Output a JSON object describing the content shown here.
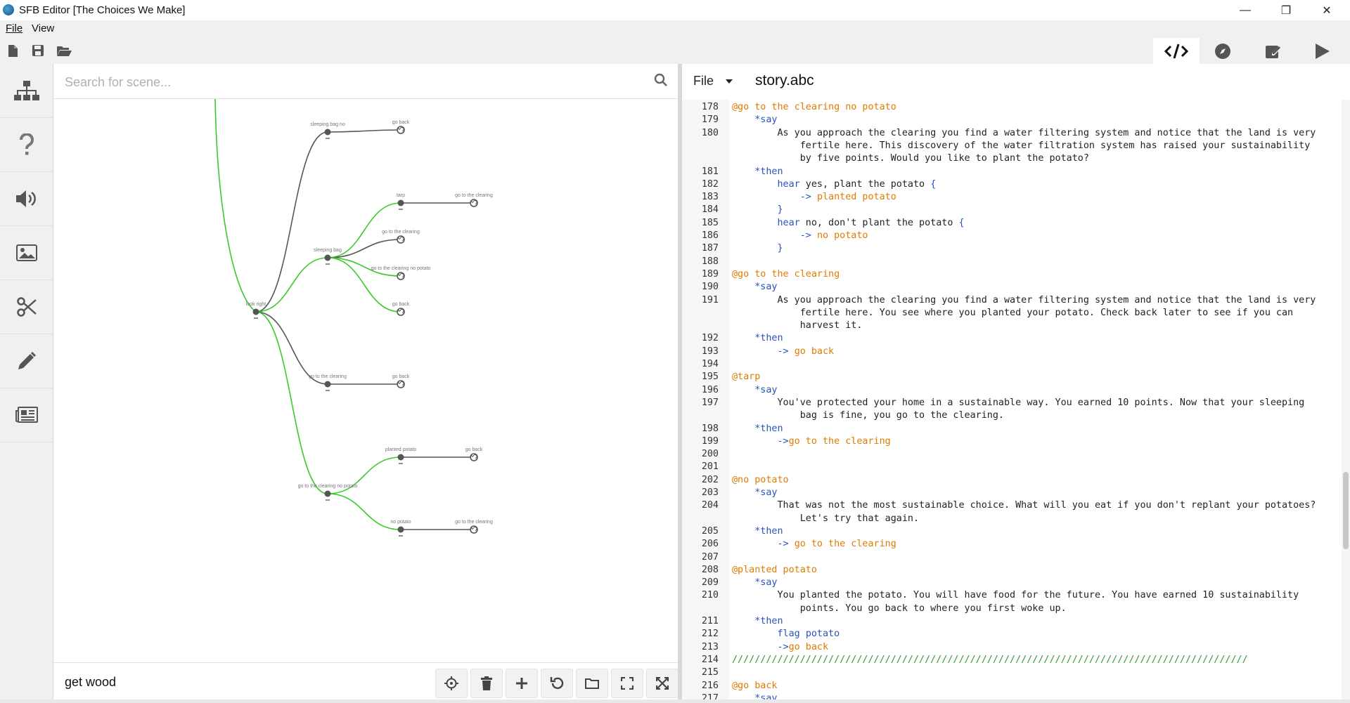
{
  "window": {
    "title": "SFB Editor [The Choices We Make]",
    "controls": {
      "minimize": "—",
      "maximize": "❐",
      "close": "✕"
    }
  },
  "menubar": {
    "items": [
      "File",
      "View"
    ]
  },
  "toolbar": {
    "left_icons": [
      "new-file-icon",
      "save-icon",
      "open-folder-icon"
    ],
    "right_tabs": [
      {
        "name": "code-tab",
        "icon": "code-icon",
        "active": true
      },
      {
        "name": "compass-tab",
        "icon": "compass-icon",
        "active": false
      },
      {
        "name": "edit-tab",
        "icon": "pencil-square-icon",
        "active": false
      },
      {
        "name": "play-tab",
        "icon": "play-icon",
        "active": false
      }
    ]
  },
  "sidebar": {
    "items": [
      "sitemap-icon",
      "question-icon",
      "speaker-icon",
      "image-icon",
      "scissors-icon",
      "pencil-icon",
      "newspaper-icon"
    ]
  },
  "graph": {
    "search_placeholder": "Search for scene...",
    "current_scene": "get wood",
    "nodes": [
      {
        "id": "sleeping_bag_no",
        "label": "sleeping bag no"
      },
      {
        "id": "back1",
        "label": "go back"
      },
      {
        "id": "tarp",
        "label": "tarp"
      },
      {
        "id": "clearing1",
        "label": "go to the clearing"
      },
      {
        "id": "sleeping_bag",
        "label": "sleeping bag"
      },
      {
        "id": "clearing2",
        "label": "go to the clearing"
      },
      {
        "id": "clearing_no_potato1",
        "label": "go to the clearing no potato"
      },
      {
        "id": "back2",
        "label": "go back"
      },
      {
        "id": "look_right",
        "label": "look right"
      },
      {
        "id": "go_clearing",
        "label": "go to the clearing"
      },
      {
        "id": "back3",
        "label": "go back"
      },
      {
        "id": "planted_potato",
        "label": "planted potato"
      },
      {
        "id": "back4",
        "label": "go back"
      },
      {
        "id": "clearing_no_potato",
        "label": "go to the clearing no potato"
      },
      {
        "id": "no_potato",
        "label": "no potato"
      },
      {
        "id": "clearing3",
        "label": "go to the clearing"
      }
    ],
    "colors": {
      "green_edge": "#3cc92b",
      "gray_edge": "#555555",
      "node": "#555555"
    }
  },
  "editor": {
    "file_menu": "File",
    "filename": "story.abc",
    "lines": [
      {
        "n": "178",
        "segs": [
          [
            "c-label",
            "@go to the clearing no potato"
          ]
        ]
      },
      {
        "n": "179",
        "segs": [
          [
            "",
            "    "
          ],
          [
            "c-kw",
            "*say"
          ]
        ]
      },
      {
        "n": "180",
        "segs": [
          [
            "",
            "        As you approach the clearing you find a water filtering system and notice that the land is very"
          ]
        ]
      },
      {
        "n": "",
        "segs": [
          [
            "",
            "            fertile here. This discovery of the water filtration system has raised your sustainability"
          ]
        ]
      },
      {
        "n": "",
        "segs": [
          [
            "",
            "            by five points. Would you like to plant the potato?"
          ]
        ]
      },
      {
        "n": "181",
        "segs": [
          [
            "",
            "    "
          ],
          [
            "c-kw",
            "*then"
          ]
        ]
      },
      {
        "n": "182",
        "segs": [
          [
            "",
            "        "
          ],
          [
            "c-kw",
            "hear"
          ],
          [
            "",
            " yes, plant the potato "
          ],
          [
            "c-brace",
            "{"
          ]
        ]
      },
      {
        "n": "183",
        "segs": [
          [
            "",
            "            "
          ],
          [
            "c-arrow",
            "->"
          ],
          [
            "",
            " "
          ],
          [
            "c-tgt",
            "planted potato"
          ]
        ]
      },
      {
        "n": "184",
        "segs": [
          [
            "",
            "        "
          ],
          [
            "c-brace",
            "}"
          ]
        ]
      },
      {
        "n": "185",
        "segs": [
          [
            "",
            "        "
          ],
          [
            "c-kw",
            "hear"
          ],
          [
            "",
            " no, don't plant the potato "
          ],
          [
            "c-brace",
            "{"
          ]
        ]
      },
      {
        "n": "186",
        "segs": [
          [
            "",
            "            "
          ],
          [
            "c-arrow",
            "->"
          ],
          [
            "",
            " "
          ],
          [
            "c-tgt",
            "no potato"
          ]
        ]
      },
      {
        "n": "187",
        "segs": [
          [
            "",
            "        "
          ],
          [
            "c-brace",
            "}"
          ]
        ]
      },
      {
        "n": "188",
        "segs": [
          [
            "",
            ""
          ]
        ]
      },
      {
        "n": "189",
        "segs": [
          [
            "c-label",
            "@go to the clearing"
          ]
        ]
      },
      {
        "n": "190",
        "segs": [
          [
            "",
            "    "
          ],
          [
            "c-kw",
            "*say"
          ]
        ]
      },
      {
        "n": "191",
        "segs": [
          [
            "",
            "        As you approach the clearing you find a water filtering system and notice that the land is very"
          ]
        ]
      },
      {
        "n": "",
        "segs": [
          [
            "",
            "            fertile here. You see where you planted your potato. Check back later to see if you can"
          ]
        ]
      },
      {
        "n": "",
        "segs": [
          [
            "",
            "            harvest it."
          ]
        ]
      },
      {
        "n": "192",
        "segs": [
          [
            "",
            "    "
          ],
          [
            "c-kw",
            "*then"
          ]
        ]
      },
      {
        "n": "193",
        "segs": [
          [
            "",
            "        "
          ],
          [
            "c-arrow",
            "->"
          ],
          [
            "",
            " "
          ],
          [
            "c-tgt",
            "go back"
          ]
        ]
      },
      {
        "n": "194",
        "segs": [
          [
            "",
            ""
          ]
        ]
      },
      {
        "n": "195",
        "segs": [
          [
            "c-label",
            "@tarp"
          ]
        ]
      },
      {
        "n": "196",
        "segs": [
          [
            "",
            "    "
          ],
          [
            "c-kw",
            "*say"
          ]
        ]
      },
      {
        "n": "197",
        "segs": [
          [
            "",
            "        You've protected your home in a sustainable way. You earned 10 points. Now that your sleeping"
          ]
        ]
      },
      {
        "n": "",
        "segs": [
          [
            "",
            "            bag is fine, you go to the clearing."
          ]
        ]
      },
      {
        "n": "198",
        "segs": [
          [
            "",
            "    "
          ],
          [
            "c-kw",
            "*then"
          ]
        ]
      },
      {
        "n": "199",
        "segs": [
          [
            "",
            "        "
          ],
          [
            "c-arrow",
            "->"
          ],
          [
            "c-tgt",
            "go to the clearing"
          ]
        ]
      },
      {
        "n": "200",
        "segs": [
          [
            "",
            ""
          ]
        ]
      },
      {
        "n": "201",
        "segs": [
          [
            "",
            ""
          ]
        ]
      },
      {
        "n": "202",
        "segs": [
          [
            "c-label",
            "@no potato"
          ]
        ]
      },
      {
        "n": "203",
        "segs": [
          [
            "",
            "    "
          ],
          [
            "c-kw",
            "*say"
          ]
        ]
      },
      {
        "n": "204",
        "segs": [
          [
            "",
            "        That was not the most sustainable choice. What will you eat if you don't replant your potatoes?"
          ]
        ]
      },
      {
        "n": "",
        "segs": [
          [
            "",
            "            Let's try that again."
          ]
        ]
      },
      {
        "n": "205",
        "segs": [
          [
            "",
            "    "
          ],
          [
            "c-kw",
            "*then"
          ]
        ]
      },
      {
        "n": "206",
        "segs": [
          [
            "",
            "        "
          ],
          [
            "c-arrow",
            "->"
          ],
          [
            "",
            " "
          ],
          [
            "c-tgt",
            "go to the clearing"
          ]
        ]
      },
      {
        "n": "207",
        "segs": [
          [
            "",
            ""
          ]
        ]
      },
      {
        "n": "208",
        "segs": [
          [
            "c-label",
            "@planted potato"
          ]
        ]
      },
      {
        "n": "209",
        "segs": [
          [
            "",
            "    "
          ],
          [
            "c-kw",
            "*say"
          ]
        ]
      },
      {
        "n": "210",
        "segs": [
          [
            "",
            "        You planted the potato. You will have food for the future. You have earned 10 sustainability"
          ]
        ]
      },
      {
        "n": "",
        "segs": [
          [
            "",
            "            points. You go back to where you first woke up."
          ]
        ]
      },
      {
        "n": "211",
        "segs": [
          [
            "",
            "    "
          ],
          [
            "c-kw",
            "*then"
          ]
        ]
      },
      {
        "n": "212",
        "segs": [
          [
            "",
            "        "
          ],
          [
            "c-kw",
            "flag"
          ],
          [
            "",
            " "
          ],
          [
            "c-arrow",
            "potato"
          ]
        ]
      },
      {
        "n": "213",
        "segs": [
          [
            "",
            "        "
          ],
          [
            "c-arrow",
            "->"
          ],
          [
            "c-tgt",
            "go back"
          ]
        ]
      },
      {
        "n": "214",
        "segs": [
          [
            "c-sep",
            "///////////////////////////////////////////////////////////////////////////////////////////"
          ]
        ]
      },
      {
        "n": "215",
        "segs": [
          [
            "",
            ""
          ]
        ]
      },
      {
        "n": "216",
        "segs": [
          [
            "c-label",
            "@go back"
          ]
        ]
      },
      {
        "n": "217",
        "segs": [
          [
            "",
            "    "
          ],
          [
            "c-kw",
            "*say"
          ]
        ]
      }
    ]
  }
}
